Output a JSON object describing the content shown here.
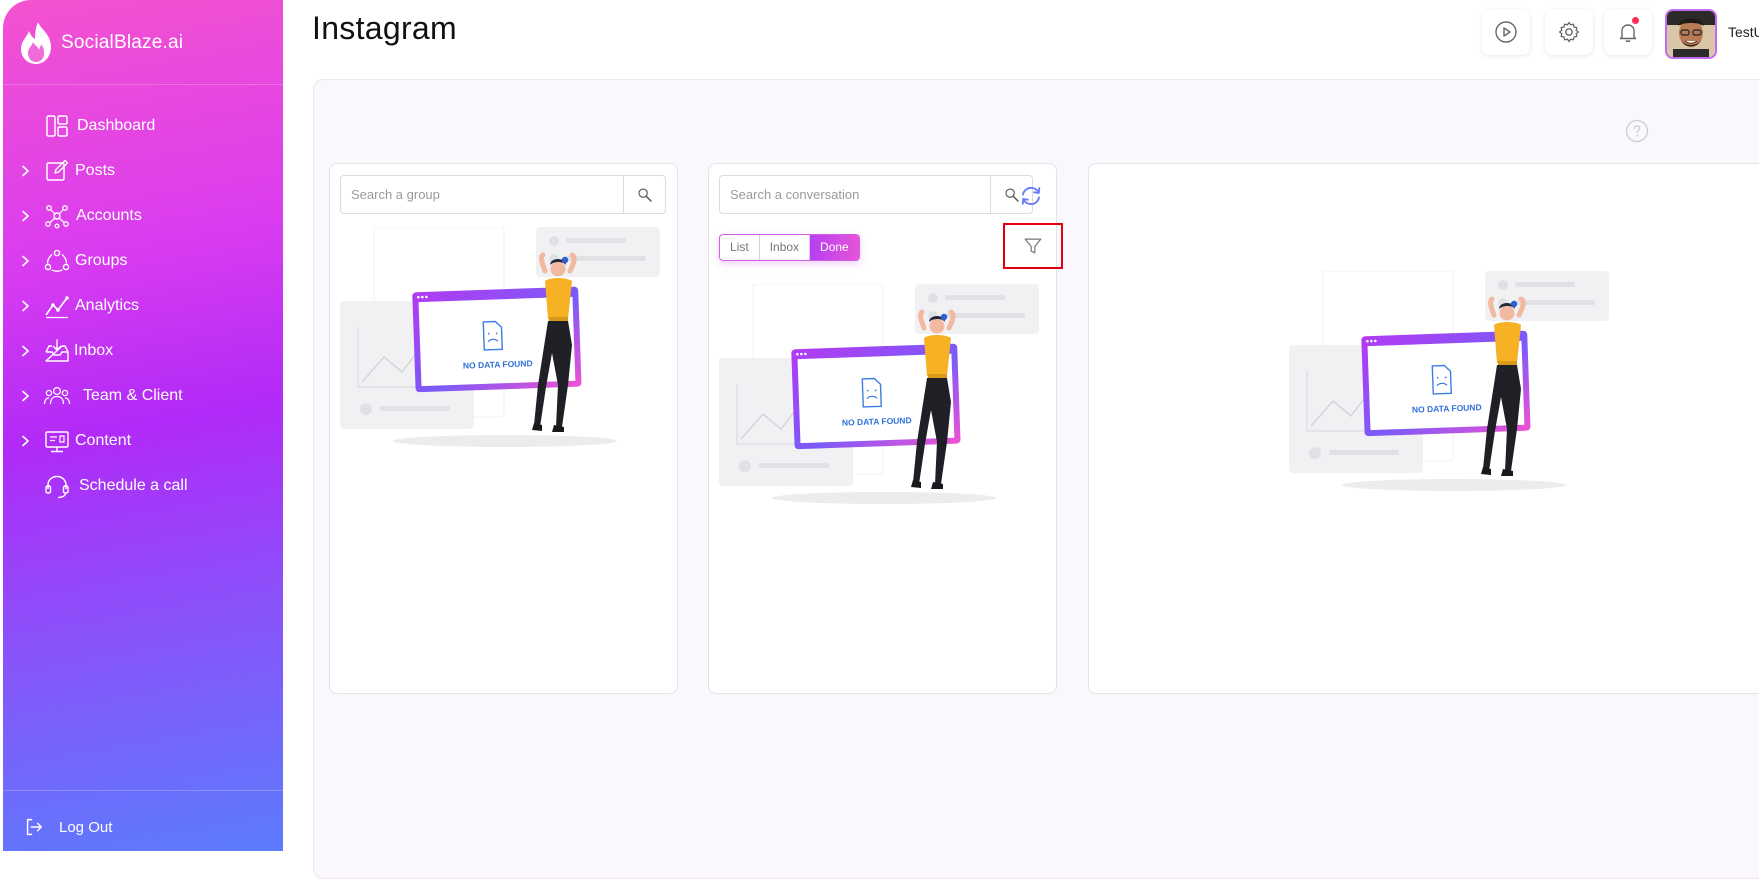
{
  "brand": {
    "name": "SocialBlaze.ai"
  },
  "sidebar": {
    "items": [
      {
        "label": "Dashboard",
        "icon": "dashboard-icon",
        "has_chevron": false
      },
      {
        "label": "Posts",
        "icon": "posts-icon",
        "has_chevron": true
      },
      {
        "label": "Accounts",
        "icon": "accounts-icon",
        "has_chevron": true
      },
      {
        "label": "Groups",
        "icon": "groups-icon",
        "has_chevron": true
      },
      {
        "label": "Analytics",
        "icon": "analytics-icon",
        "has_chevron": true
      },
      {
        "label": "Inbox",
        "icon": "inbox-icon",
        "has_chevron": true
      },
      {
        "label": "Team & Client",
        "icon": "team-icon",
        "has_chevron": true
      },
      {
        "label": "Content",
        "icon": "content-icon",
        "has_chevron": true
      },
      {
        "label": "Schedule a call",
        "icon": "headset-icon",
        "has_chevron": false
      }
    ],
    "logout_label": "Log Out"
  },
  "header": {
    "title": "Instagram",
    "user_name": "TestU",
    "icons": [
      "play-icon",
      "gear-icon",
      "bell-icon"
    ]
  },
  "groups_panel": {
    "search_placeholder": "Search a group",
    "empty_text": "NO DATA FOUND"
  },
  "conversations_panel": {
    "search_placeholder": "Search a conversation",
    "tabs": [
      "List",
      "Inbox",
      "Done"
    ],
    "active_tab": "Done",
    "empty_text": "NO DATA FOUND"
  },
  "detail_panel": {
    "empty_text": "NO DATA FOUND"
  },
  "colors": {
    "brand_gradient_top": "#f452cf",
    "brand_gradient_mid": "#b12af7",
    "brand_gradient_bottom": "#5b7cfc",
    "highlight_red": "#e0000f",
    "notification_dot": "#ff2d55"
  }
}
